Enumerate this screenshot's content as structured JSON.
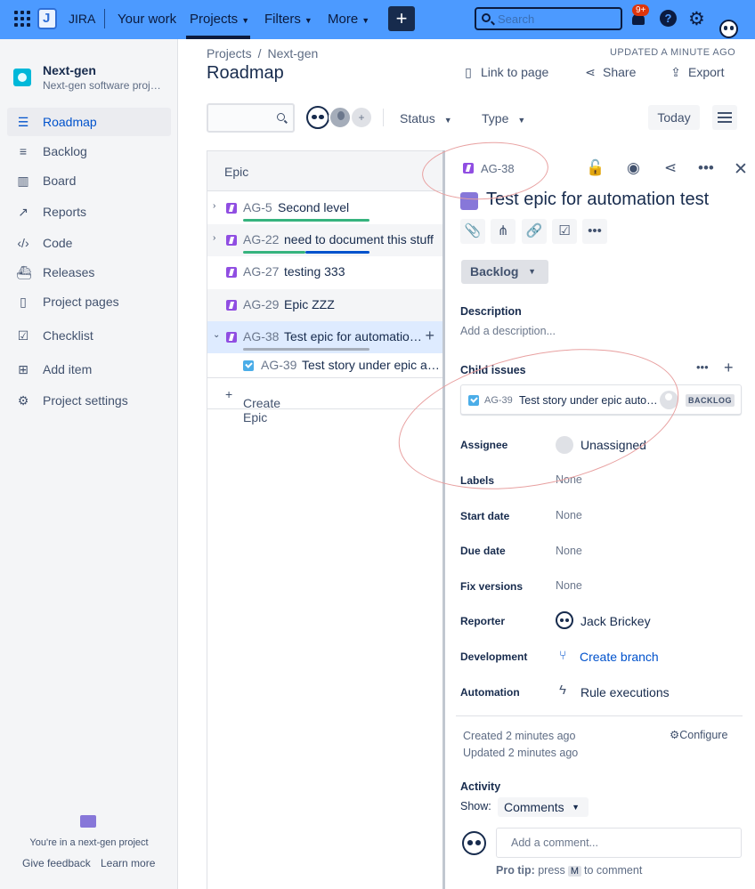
{
  "topnav": {
    "app_name": "JIRA",
    "your_work": "Your work",
    "projects": "Projects",
    "filters": "Filters",
    "more": "More",
    "search_placeholder": "Search",
    "notification_count": "9+"
  },
  "sidebar": {
    "project_name": "Next-gen",
    "project_sub": "Next-gen software proj…",
    "items": [
      {
        "label": "Roadmap",
        "icon": "roadmap-icon"
      },
      {
        "label": "Backlog",
        "icon": "backlog-icon"
      },
      {
        "label": "Board",
        "icon": "board-icon"
      },
      {
        "label": "Reports",
        "icon": "reports-icon"
      },
      {
        "label": "Code",
        "icon": "code-icon"
      },
      {
        "label": "Releases",
        "icon": "releases-icon"
      },
      {
        "label": "Project pages",
        "icon": "pages-icon"
      },
      {
        "label": "Checklist",
        "icon": "checklist-icon"
      },
      {
        "label": "Add item",
        "icon": "add-item-icon"
      },
      {
        "label": "Project settings",
        "icon": "settings-icon"
      }
    ],
    "footer_text": "You're in a next-gen project",
    "give_feedback": "Give feedback",
    "learn_more": "Learn more"
  },
  "header": {
    "breadcrumb_projects": "Projects",
    "breadcrumb_sep": "/",
    "breadcrumb_project": "Next-gen",
    "title": "Roadmap",
    "updated": "UPDATED A MINUTE AGO",
    "link_to_page": "Link to page",
    "share": "Share",
    "export": "Export"
  },
  "filters": {
    "status": "Status",
    "type": "Type",
    "today": "Today"
  },
  "roadmap": {
    "column_header": "Epic",
    "rows": [
      {
        "key": "AG-5",
        "title": "Second level"
      },
      {
        "key": "AG-22",
        "title": "need to document this stuff"
      },
      {
        "key": "AG-27",
        "title": "testing 333"
      },
      {
        "key": "AG-29",
        "title": "Epic ZZZ"
      },
      {
        "key": "AG-38",
        "title": "Test epic for automatio…"
      },
      {
        "key": "AG-39",
        "title": "Test story under epic a…"
      }
    ],
    "create_epic": "Create Epic"
  },
  "panel": {
    "key": "AG-38",
    "title": "Test epic for automation test",
    "status": "Backlog",
    "description_label": "Description",
    "description_placeholder": "Add a description...",
    "child_issues_label": "Child issues",
    "child": {
      "key": "AG-39",
      "title": "Test story under epic auto…",
      "status": "BACKLOG"
    },
    "fields": {
      "assignee_label": "Assignee",
      "assignee_value": "Unassigned",
      "labels_label": "Labels",
      "labels_value": "None",
      "start_label": "Start date",
      "start_value": "None",
      "due_label": "Due date",
      "due_value": "None",
      "fix_label": "Fix versions",
      "fix_value": "None",
      "reporter_label": "Reporter",
      "reporter_value": "Jack Brickey",
      "development_label": "Development",
      "development_value": "Create branch",
      "automation_label": "Automation",
      "automation_value": "Rule executions"
    },
    "created": "Created 2 minutes ago",
    "updated": "Updated 2 minutes ago",
    "configure": "Configure",
    "activity_label": "Activity",
    "show_label": "Show:",
    "show_value": "Comments",
    "comment_placeholder": "Add a comment...",
    "protip_bold": "Pro tip:",
    "protip_press": "press",
    "protip_key": "M",
    "protip_rest": "to comment"
  },
  "colors": {
    "topnav_bg": "#4c9aff",
    "epic_purple": "#904ee2",
    "bar_green": "#36b37e",
    "bar_blue": "#0052cc",
    "bar_grey": "#a5adba",
    "link_blue": "#0052cc"
  }
}
